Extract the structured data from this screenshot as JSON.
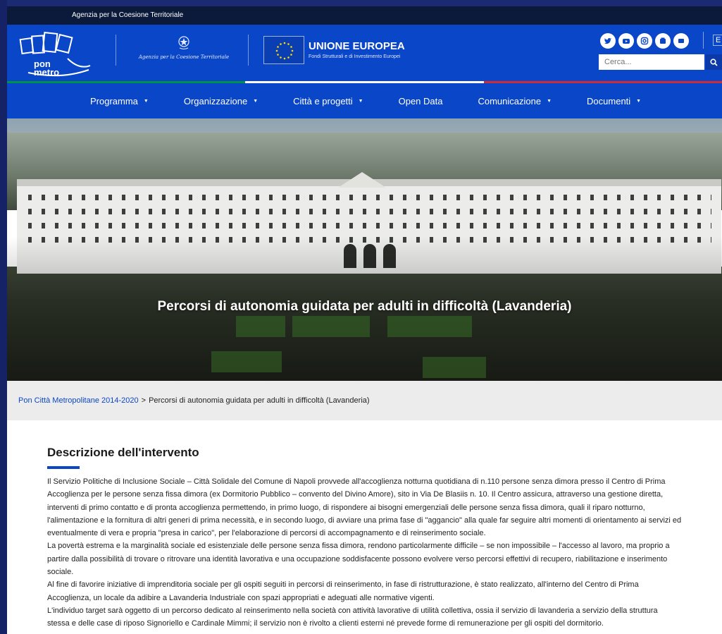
{
  "topbar": {
    "agency_label": "Agenzia per la Coesione Territoriale"
  },
  "header": {
    "logo_text_line1": "pon",
    "logo_text_line2": "metro",
    "agency_name": "Agenzia per la Coesione Territoriale",
    "eu_title": "UNIONE EUROPEA",
    "eu_subtitle": "Fondi Strutturali e di Investimento Europei",
    "lang_label": "E",
    "search_placeholder": "Cerca...",
    "socials": [
      "twitter-icon",
      "youtube-icon",
      "instagram-icon",
      "flickr-icon",
      "contact-icon"
    ]
  },
  "nav": {
    "items": [
      {
        "label": "Programma",
        "has_dropdown": true
      },
      {
        "label": "Organizzazione",
        "has_dropdown": true
      },
      {
        "label": "Città e progetti",
        "has_dropdown": true
      },
      {
        "label": "Open Data",
        "has_dropdown": false
      },
      {
        "label": "Comunicazione",
        "has_dropdown": true
      },
      {
        "label": "Documenti",
        "has_dropdown": true
      }
    ]
  },
  "hero": {
    "title": "Percorsi di autonomia guidata per adulti in difficoltà (Lavanderia)"
  },
  "breadcrumb": {
    "home": "Pon Città Metropolitane 2014-2020",
    "separator": ">",
    "current": "Percorsi di autonomia guidata per adulti in difficoltà (Lavanderia)"
  },
  "content": {
    "section_title": "Descrizione dell'intervento",
    "paragraphs": [
      "Il Servizio Politiche di Inclusione Sociale – Città Solidale del Comune di Napoli provvede all'accoglienza notturna quotidiana di n.110 persone senza dimora presso il Centro di Prima Accoglienza per le persone senza fissa dimora (ex Dormitorio Pubblico – convento del Divino Amore), sito in Via De Blasiis n. 10. Il Centro assicura, attraverso una gestione diretta, interventi di primo contatto e di pronta accoglienza permettendo, in primo luogo, di rispondere ai bisogni emergenziali delle persone senza fissa dimora, quali il riparo notturno, l'alimentazione e la fornitura di altri generi di prima necessità, e in secondo luogo, di avviare una prima fase di \"aggancio\" alla quale far seguire altri momenti di orientamento ai servizi ed eventualmente di vera e propria \"presa in carico\", per l'elaborazione di percorsi di accompagnamento e di reinserimento sociale.",
      "La povertà estrema e la marginalità sociale ed esistenziale delle persone senza fissa dimora, rendono particolarmente difficile – se non impossibile – l'accesso al lavoro, ma proprio a partire dalla possibilità di trovare o ritrovare una identità lavorativa e una occupazione soddisfacente possono evolvere verso percorsi effettivi di recupero, riabilitazione e inserimento sociale.",
      "Al fine di favorire iniziative di imprenditoria sociale per gli ospiti seguiti in percorsi di reinserimento, in fase di ristrutturazione, è stato realizzato, all'interno del Centro di Prima Accoglienza, un locale da adibire a Lavanderia Industriale con spazi appropriati e adeguati alle normative vigenti.",
      "L'individuo target sarà oggetto di un percorso dedicato al reinserimento nella società con attività lavorative di utilità collettiva, ossia il servizio di lavanderia a servizio della struttura stessa e delle case di riposo Signoriello e Cardinale Mimmi; il servizio non è rivolto a clienti esterni né prevede forme di remunerazione per gli ospiti del dormitorio."
    ]
  },
  "colors": {
    "brand_blue": "#0a46c8",
    "topbar_dark": "#0b1a3b",
    "flag_green": "#009246",
    "flag_white": "#ffffff",
    "flag_red": "#ce2b37",
    "breadcrumb_bg": "#ececec"
  }
}
